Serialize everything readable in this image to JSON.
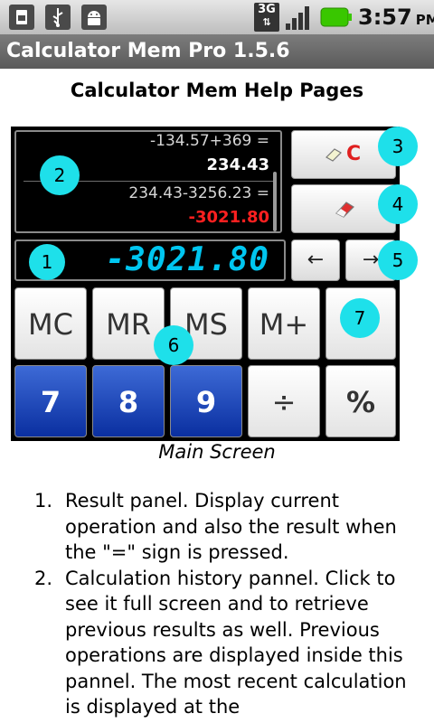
{
  "status_bar": {
    "icons": [
      "sd-card-icon",
      "usb-icon",
      "android-debug-icon",
      "3g-icon",
      "signal-bars-icon",
      "battery-icon"
    ],
    "network": "3G",
    "time": "3:57",
    "ampm": "PM"
  },
  "app": {
    "title": "Calculator Mem Pro 1.5.6"
  },
  "page": {
    "heading": "Calculator Mem Help Pages",
    "caption": "Main Screen"
  },
  "calc": {
    "history_line1": "-134.57+369 =",
    "history_result1": "234.43",
    "history_line2": "234.43-3256.23 =",
    "history_result2": "-3021.80",
    "display": "-3021.80",
    "clear_label": "C",
    "back_arrow": "←",
    "fwd_arrow": "→",
    "mem_keys": [
      "MC",
      "MR",
      "MS",
      "M+"
    ],
    "digit_keys": [
      "7",
      "8",
      "9"
    ],
    "op_keys": [
      "÷",
      "%"
    ],
    "accent_color": "#1ee0ea",
    "display_color": "#00c6f0",
    "negative_color": "#ff2020"
  },
  "badges": [
    "1",
    "2",
    "3",
    "4",
    "5",
    "6",
    "7"
  ],
  "help_items": [
    {
      "number": "1.",
      "text": "Result panel. Display current operation and also the result when the \"=\" sign is pressed."
    },
    {
      "number": "2.",
      "text": "Calculation history pannel. Click to see it full screen and to retrieve previous results as well. Previous operations are displayed inside this pannel. The most recent calculation is displayed at the"
    }
  ]
}
